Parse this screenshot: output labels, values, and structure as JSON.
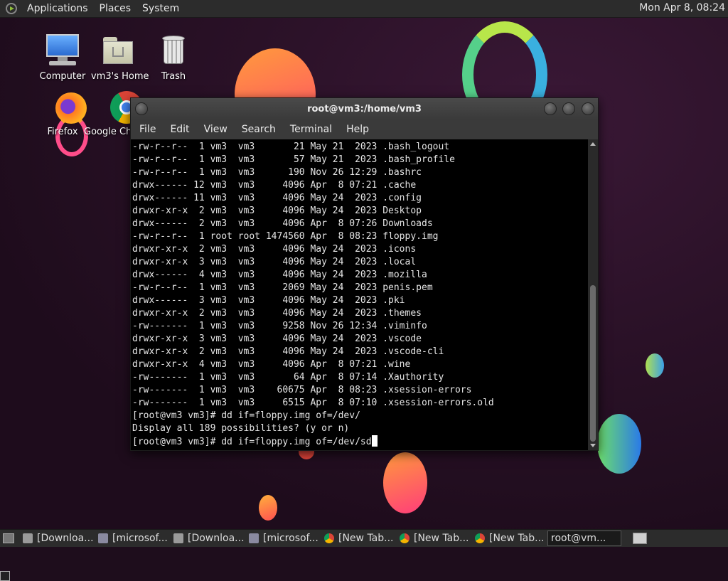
{
  "top_panel": {
    "menus": [
      "Applications",
      "Places",
      "System"
    ],
    "clock": "Mon Apr  8, 08:24"
  },
  "desktop_icons": [
    {
      "label": "Computer"
    },
    {
      "label": "vm3's Home"
    },
    {
      "label": "Trash"
    },
    {
      "label": "Firefox"
    },
    {
      "label": "Google Ch"
    }
  ],
  "terminal": {
    "title": "root@vm3:/home/vm3",
    "menus": [
      "File",
      "Edit",
      "View",
      "Search",
      "Terminal",
      "Help"
    ],
    "lines": [
      "-rw-r--r--  1 vm3  vm3       21 May 21  2023 .bash_logout",
      "-rw-r--r--  1 vm3  vm3       57 May 21  2023 .bash_profile",
      "-rw-r--r--  1 vm3  vm3      190 Nov 26 12:29 .bashrc",
      "drwx------ 12 vm3  vm3     4096 Apr  8 07:21 .cache",
      "drwx------ 11 vm3  vm3     4096 May 24  2023 .config",
      "drwxr-xr-x  2 vm3  vm3     4096 May 24  2023 Desktop",
      "drwx------  2 vm3  vm3     4096 Apr  8 07:26 Downloads",
      "-rw-r--r--  1 root root 1474560 Apr  8 08:23 floppy.img",
      "drwxr-xr-x  2 vm3  vm3     4096 May 24  2023 .icons",
      "drwxr-xr-x  3 vm3  vm3     4096 May 24  2023 .local",
      "drwx------  4 vm3  vm3     4096 May 24  2023 .mozilla",
      "-rw-r--r--  1 vm3  vm3     2069 May 24  2023 penis.pem",
      "drwx------  3 vm3  vm3     4096 May 24  2023 .pki",
      "drwxr-xr-x  2 vm3  vm3     4096 May 24  2023 .themes",
      "-rw-------  1 vm3  vm3     9258 Nov 26 12:34 .viminfo",
      "drwxr-xr-x  3 vm3  vm3     4096 May 24  2023 .vscode",
      "drwxr-xr-x  2 vm3  vm3     4096 May 24  2023 .vscode-cli",
      "drwxr-xr-x  4 vm3  vm3     4096 Apr  8 07:21 .wine",
      "-rw-------  1 vm3  vm3       64 Apr  8 07:14 .Xauthority",
      "-rw-------  1 vm3  vm3    60675 Apr  8 08:23 .xsession-errors",
      "-rw-------  1 vm3  vm3     6515 Apr  8 07:10 .xsession-errors.old",
      "[root@vm3 vm3]# dd if=floppy.img of=/dev/",
      "Display all 189 possibilities? (y or n)"
    ],
    "prompt_line": "[root@vm3 vm3]# dd if=floppy.img of=/dev/sd"
  },
  "taskbar": {
    "tasks": [
      {
        "label": "[Downloa...",
        "icon": "folder-icon"
      },
      {
        "label": "[microsof...",
        "icon": "editor-icon"
      },
      {
        "label": "[Downloa...",
        "icon": "folder-icon"
      },
      {
        "label": "[microsof...",
        "icon": "editor-icon"
      },
      {
        "label": "[New Tab...",
        "icon": "chrome-icon"
      },
      {
        "label": "[New Tab...",
        "icon": "chrome-icon"
      },
      {
        "label": "[New Tab...",
        "icon": "chrome-icon"
      },
      {
        "label": "root@vm...",
        "icon": "terminal-icon",
        "active": true
      }
    ]
  }
}
